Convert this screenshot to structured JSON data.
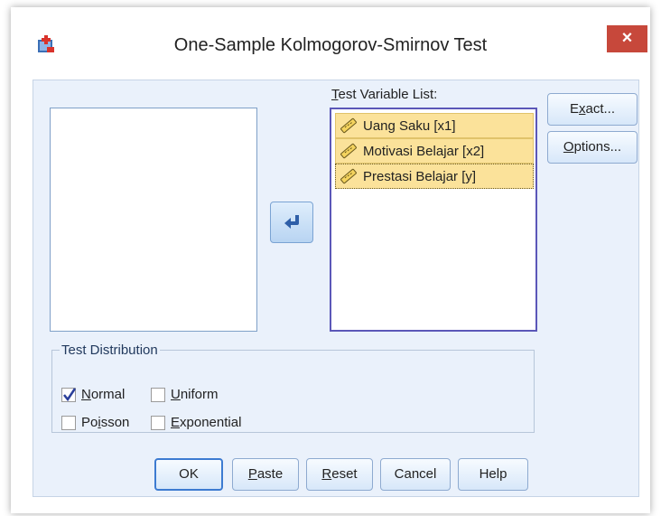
{
  "window": {
    "title": "One-Sample Kolmogorov-Smirnov Test",
    "close_label": "×",
    "app_icon": "spss-dialog-icon"
  },
  "source_list": {
    "items": []
  },
  "target_list": {
    "label_prefix": "T",
    "label_rest": "est Variable List:",
    "items": [
      {
        "label": "Uang Saku [x1]",
        "icon": "ruler-scale-icon"
      },
      {
        "label": "Motivasi Belajar [x2]",
        "icon": "ruler-scale-icon"
      },
      {
        "label": "Prestasi Belajar [y]",
        "icon": "ruler-scale-icon"
      }
    ]
  },
  "move_button": {
    "icon": "arrow-left-icon"
  },
  "side_buttons": {
    "exact": {
      "pre": "E",
      "mn": "x",
      "post": "act..."
    },
    "options": {
      "pre": "",
      "mn": "O",
      "post": "ptions..."
    }
  },
  "test_distribution": {
    "legend": "Test Distribution",
    "options": {
      "normal": {
        "pre": "",
        "mn": "N",
        "post": "ormal",
        "checked": true
      },
      "uniform": {
        "pre": "",
        "mn": "U",
        "post": "niform",
        "checked": false
      },
      "poisson": {
        "pre": "Po",
        "mn": "i",
        "post": "sson",
        "checked": false
      },
      "exponential": {
        "pre": "",
        "mn": "E",
        "post": "xponential",
        "checked": false
      }
    }
  },
  "footer_buttons": {
    "ok": "OK",
    "paste": {
      "pre": "",
      "mn": "P",
      "post": "aste"
    },
    "reset": {
      "pre": "",
      "mn": "R",
      "post": "eset"
    },
    "cancel": "Cancel",
    "help": "Help"
  },
  "colors": {
    "client_bg": "#eaf1fb",
    "selection": "#fbe29a",
    "close": "#c7483b",
    "focus_border": "#5b57b8"
  }
}
